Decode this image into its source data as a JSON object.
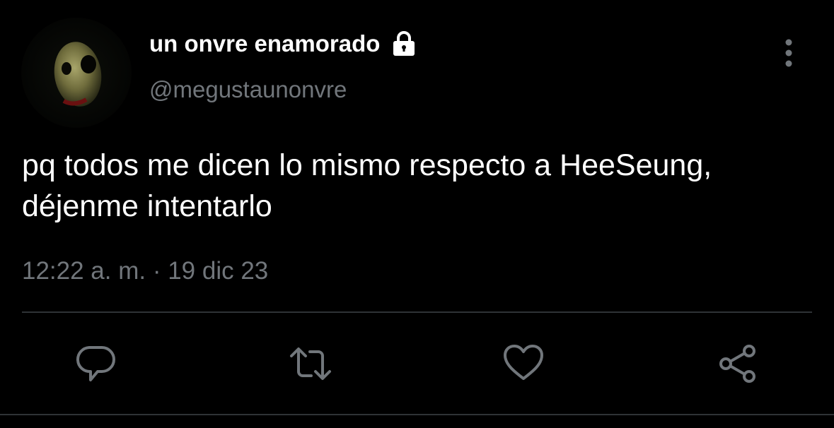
{
  "tweet": {
    "display_name": "un onvre enamorado",
    "handle": "@megustaunonvre",
    "text_line_1": "pq todos me dicen lo mismo respecto a HeeSeung,",
    "text_line_2": "déjenme intentarlo",
    "timestamp": "12:22 a. m. · 19 dic 23",
    "protected_icon": "lock-icon"
  },
  "actions": {
    "reply_icon": "reply-icon",
    "retweet_icon": "retweet-icon",
    "like_icon": "heart-icon",
    "share_icon": "share-icon",
    "more_icon": "more-vertical-icon"
  },
  "colors": {
    "background": "#000000",
    "primary_text": "#ffffff",
    "secondary_text": "#71767b",
    "divider": "#2f3336",
    "icon": "#71767b"
  }
}
